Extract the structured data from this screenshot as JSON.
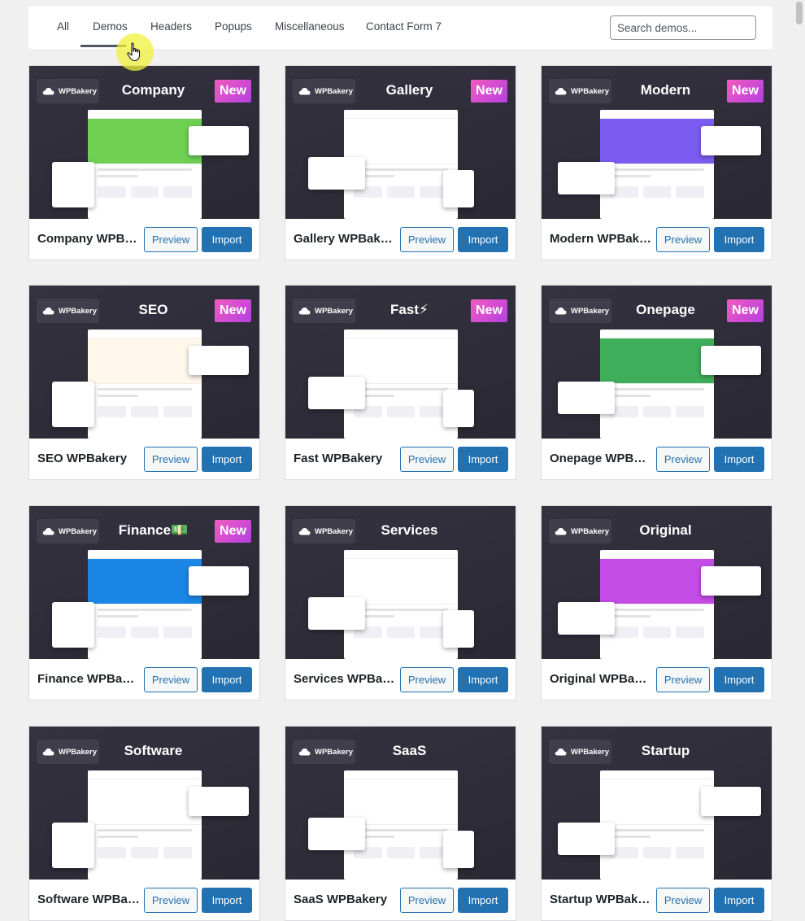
{
  "filters": {
    "tabs": [
      "All",
      "Demos",
      "Headers",
      "Popups",
      "Miscellaneous",
      "Contact Form 7"
    ],
    "active": "Demos",
    "search_placeholder": "Search demos..."
  },
  "brand_badge": "WPBakery",
  "new_label": "New",
  "preview_label": "Preview",
  "import_label": "Import",
  "accent": "#2271b1",
  "new_badge_gradient": [
    "#f35cc0",
    "#b43fe1"
  ],
  "demos": [
    {
      "title": "Company",
      "name": "Company WPBakery",
      "is_new": true,
      "hero": "#6fcf53"
    },
    {
      "title": "Gallery",
      "name": "Gallery WPBakery",
      "is_new": true,
      "hero": "#ffffff"
    },
    {
      "title": "Modern",
      "name": "Modern WPBakery",
      "is_new": true,
      "hero": "#7b5cf0"
    },
    {
      "title": "SEO",
      "name": "SEO WPBakery",
      "is_new": true,
      "hero": "#fff7ea"
    },
    {
      "title": "Fast⚡",
      "name": "Fast WPBakery",
      "is_new": true,
      "hero": "#ffffff"
    },
    {
      "title": "Onepage",
      "name": "Onepage WPBakery",
      "is_new": true,
      "hero": "#3fae5b"
    },
    {
      "title": "Finance💵",
      "name": "Finance WPBakery",
      "is_new": true,
      "hero": "#1b86e6"
    },
    {
      "title": "Services",
      "name": "Services WPBakery",
      "is_new": false,
      "hero": "#ffffff"
    },
    {
      "title": "Original",
      "name": "Original WPBakery",
      "is_new": false,
      "hero": "#c44ce6"
    },
    {
      "title": "Software",
      "name": "Software WPBakery",
      "is_new": false,
      "hero": "#ffffff"
    },
    {
      "title": "SaaS",
      "name": "SaaS WPBakery",
      "is_new": false,
      "hero": "#ffffff"
    },
    {
      "title": "Startup",
      "name": "Startup WPBakery",
      "is_new": false,
      "hero": "#ffffff"
    }
  ]
}
